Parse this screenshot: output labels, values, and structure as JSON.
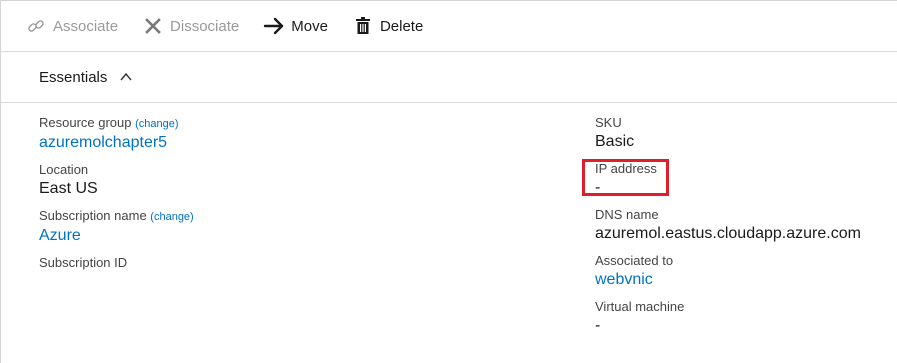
{
  "toolbar": {
    "associate_label": "Associate",
    "dissociate_label": "Dissociate",
    "move_label": "Move",
    "delete_label": "Delete"
  },
  "essentials": {
    "label": "Essentials"
  },
  "left": {
    "resource_group_label": "Resource group",
    "resource_group_change": "(change)",
    "resource_group_value": "azuremolchapter5",
    "location_label": "Location",
    "location_value": "East US",
    "subscription_name_label": "Subscription name",
    "subscription_name_change": "(change)",
    "subscription_name_value": "Azure",
    "subscription_id_label": "Subscription ID"
  },
  "right": {
    "sku_label": "SKU",
    "sku_value": "Basic",
    "ip_label": "IP address",
    "ip_value": "-",
    "dns_label": "DNS name",
    "dns_value": "azuremol.eastus.cloudapp.azure.com",
    "associated_label": "Associated to",
    "associated_value": "webvnic",
    "vm_label": "Virtual machine",
    "vm_value": "-"
  },
  "colors": {
    "link": "#0072c6",
    "highlight": "#e01e2b",
    "disabled": "#9a9a9a"
  },
  "icons": {
    "associate": "link-icon",
    "dissociate": "x-icon",
    "move": "arrow-right-icon",
    "delete": "trash-icon",
    "essentials": "chevron-up-icon"
  }
}
